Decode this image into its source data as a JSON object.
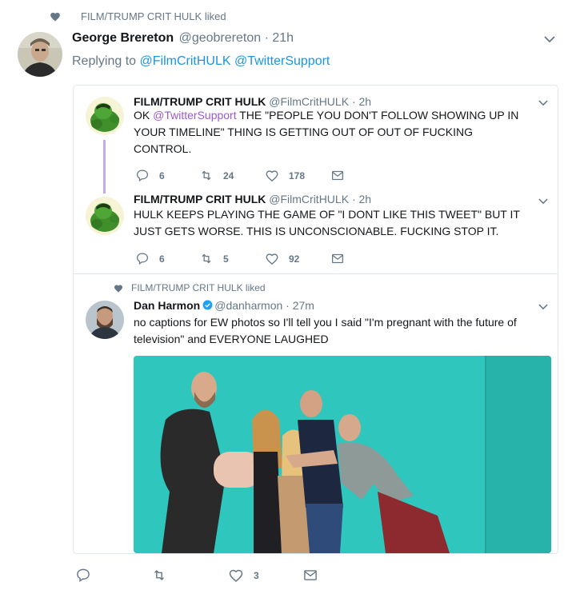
{
  "top_context": {
    "text": "FILM/TRUMP CRIT HULK liked"
  },
  "main_tweet": {
    "name": "George Brereton",
    "handle": "@geobrereton",
    "time": "21h",
    "replying_label": "Replying to",
    "reply_to_1": "@FilmCritHULK",
    "reply_to_2": "@TwitterSupport",
    "actions": {
      "reply": "",
      "retweet": "",
      "like": "3"
    }
  },
  "quote": {
    "tweet1": {
      "name": "FILM/TRUMP CRIT HULK",
      "handle": "@FilmCritHULK",
      "time": "2h",
      "text_prefix": "OK ",
      "mention": "@TwitterSupport",
      "text_rest": " THE \"PEOPLE YOU DON'T FOLLOW SHOWING UP IN YOUR TIMELINE\" THING IS GETTING OUT OF OUT OF FUCKING CONTROL.",
      "actions": {
        "reply": "6",
        "retweet": "24",
        "like": "178"
      }
    },
    "tweet2": {
      "name": "FILM/TRUMP CRIT HULK",
      "handle": "@FilmCritHULK",
      "time": "2h",
      "text": "HULK KEEPS PLAYING THE GAME OF \"I DONT LIKE THIS TWEET\" BUT IT JUST GETS WORSE. THIS IS UNCONSCIONABLE. FUCKING STOP IT.",
      "actions": {
        "reply": "6",
        "retweet": "5",
        "like": "92"
      }
    },
    "liked_context": {
      "text": "FILM/TRUMP CRIT HULK liked"
    },
    "tweet3": {
      "name": "Dan Harmon",
      "handle": "@danharmon",
      "time": "27m",
      "text": "no captions for EW photos so I'll tell you I said \"I'm pregnant with the future of television\" and EVERYONE LAUGHED"
    }
  },
  "colors": {
    "link": "#1b95e0",
    "mention_purple": "#9b59d0",
    "photo_bg": "#2ec6bd",
    "gray": "#657786",
    "thread": "#c8a7e6"
  }
}
